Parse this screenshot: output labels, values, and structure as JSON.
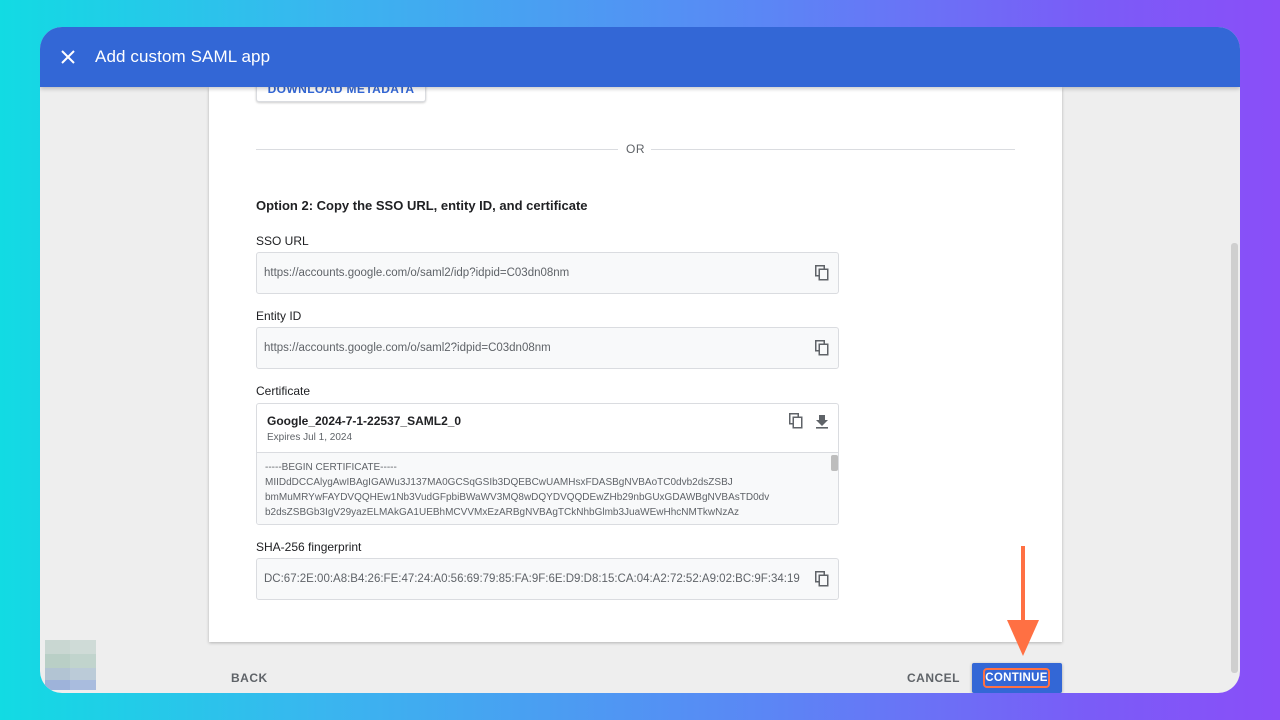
{
  "window": {
    "title": "Add custom SAML app",
    "close_icon": "close-icon"
  },
  "card": {
    "download_button": "DOWNLOAD METADATA",
    "divider_text": "OR",
    "option_heading": "Option 2: Copy the SSO URL, entity ID, and certificate",
    "sso_url": {
      "label": "SSO URL",
      "value": "https://accounts.google.com/o/saml2/idp?idpid=C03dn08nm"
    },
    "entity_id": {
      "label": "Entity ID",
      "value": "https://accounts.google.com/o/saml2?idpid=C03dn08nm"
    },
    "certificate": {
      "label": "Certificate",
      "name": "Google_2024-7-1-22537_SAML2_0",
      "expires": "Expires Jul 1, 2024",
      "lines": [
        "-----BEGIN CERTIFICATE-----",
        "MIIDdDCCAlygAwIBAgIGAWu3J137MA0GCSqGSIb3DQEBCwUAMHsxFDASBgNVBAoTC0dvb2dsZSBJ",
        "bmMuMRYwFAYDVQQHEw1Nb3VudGFpbiBWaWV3MQ8wDQYDVQQDEwZHb29nbGUxGDAWBgNVBAsTD0dv",
        "b2dsZSBGb3IgV29yazELMAkGA1UEBhMCVVMxEzARBgNVBAgTCkNhbGlmb3JuaWEwHhcNMTkwNzAz"
      ]
    },
    "fingerprint": {
      "label": "SHA-256 fingerprint",
      "value": "DC:67:2E:00:A8:B4:26:FE:47:24:A0:56:69:79:85:FA:9F:6E:D9:D8:15:CA:04:A2:72:52:A9:02:BC:9F:34:19"
    }
  },
  "footer": {
    "back": "BACK",
    "cancel": "CANCEL",
    "continue": "CONTINUE"
  },
  "colors": {
    "header": "#3367d6",
    "accent": "#ff7043"
  }
}
